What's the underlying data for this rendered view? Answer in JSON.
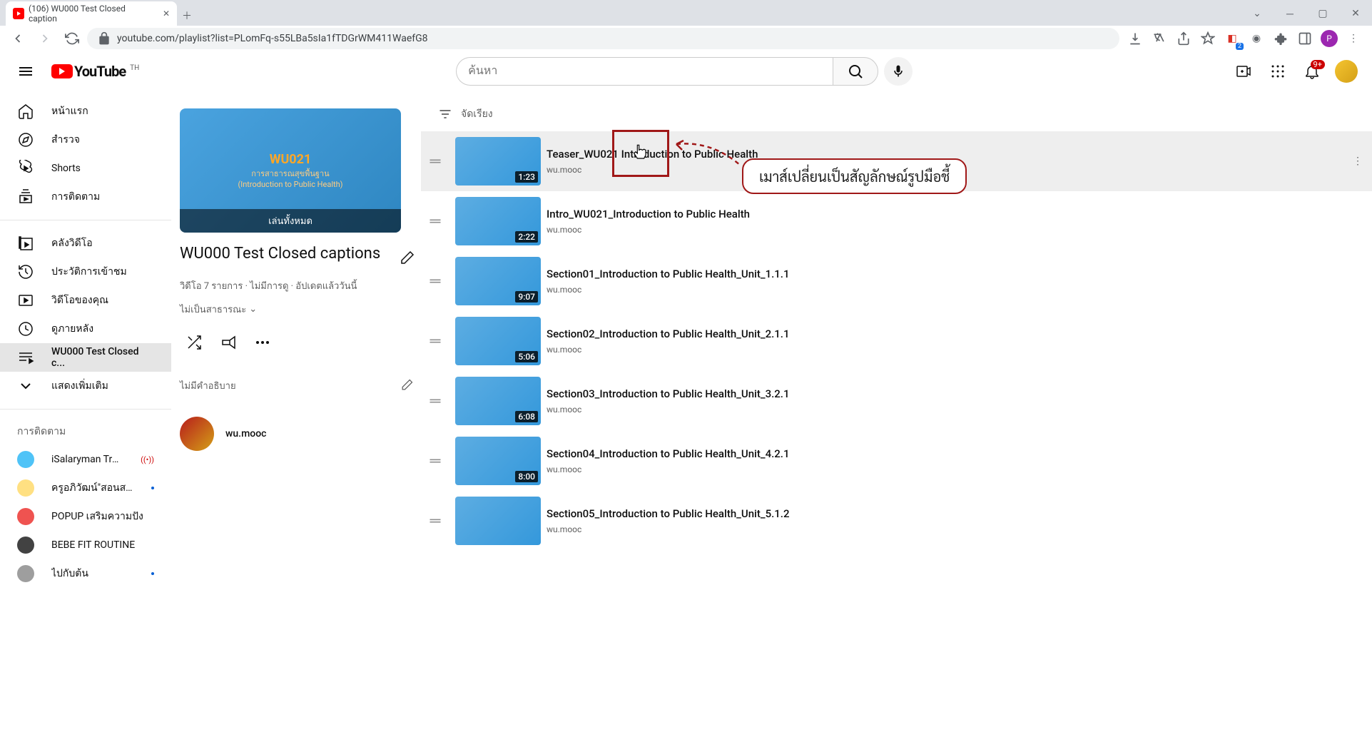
{
  "browser": {
    "tab_title": "(106) WU000 Test Closed caption",
    "url": "youtube.com/playlist?list=PLomFq-s55LBa5sIa1fTDGrWM411WaefG8",
    "ext_badge": "2",
    "profile_letter": "P"
  },
  "yt": {
    "logo_text": "YouTube",
    "logo_region": "TH",
    "search_placeholder": "ค้นหา",
    "notif_count": "9+"
  },
  "sidebar": {
    "items": [
      {
        "label": "หน้าแรก",
        "icon": "home"
      },
      {
        "label": "สำรวจ",
        "icon": "compass"
      },
      {
        "label": "Shorts",
        "icon": "shorts"
      },
      {
        "label": "การติดตาม",
        "icon": "subscriptions"
      }
    ],
    "library": [
      {
        "label": "คลังวิดีโอ",
        "icon": "library"
      },
      {
        "label": "ประวัติการเข้าชม",
        "icon": "history"
      },
      {
        "label": "วิดีโอของคุณ",
        "icon": "your-videos"
      },
      {
        "label": "ดูภายหลัง",
        "icon": "watch-later"
      },
      {
        "label": "WU000 Test Closed c...",
        "icon": "playlist",
        "active": true
      },
      {
        "label": "แสดงเพิ่มเติม",
        "icon": "chevron-down"
      }
    ],
    "subs_heading": "การติดตาม",
    "subs": [
      {
        "name": "iSalaryman Trader",
        "live": true,
        "color": "#4fc3f7"
      },
      {
        "name": "ครูอภิวัฒน์\"สอนสร้าง...",
        "dot": true,
        "color": "#ffe082"
      },
      {
        "name": "POPUP เสริมความปัง",
        "dot": false,
        "color": "#ef5350"
      },
      {
        "name": "BEBE FIT ROUTINE",
        "dot": false,
        "color": "#424242"
      },
      {
        "name": "ไปกับต้น",
        "dot": true,
        "color": "#9e9e9e"
      }
    ]
  },
  "playlist": {
    "thumb_play_all": "เล่นทั้งหมด",
    "thumb_code": "WU021",
    "thumb_line1": "การสาธารณสุขพื้นฐาน",
    "thumb_line2": "(Introduction to Public Health)",
    "title": "WU000 Test Closed captions",
    "meta": "วิดีโอ 7 รายการ · ไม่มีการดู · อัปเดตแล้ววันนี้",
    "privacy": "ไม่เป็นสาธารณะ",
    "desc_placeholder": "ไม่มีคำอธิบาย",
    "owner": "wu.mooc"
  },
  "sort_label": "จัดเรียง",
  "videos": [
    {
      "title": "Teaser_WU021 Introduction to Public Health",
      "channel": "wu.mooc",
      "dur": "1:23",
      "hover": true
    },
    {
      "title": "Intro_WU021_Introduction to Public Health",
      "channel": "wu.mooc",
      "dur": "2:22"
    },
    {
      "title": "Section01_Introduction to Public Health_Unit_1.1.1",
      "channel": "wu.mooc",
      "dur": "9:07"
    },
    {
      "title": "Section02_Introduction to Public Health_Unit_2.1.1",
      "channel": "wu.mooc",
      "dur": "5:06"
    },
    {
      "title": "Section03_Introduction to Public Health_Unit_3.2.1",
      "channel": "wu.mooc",
      "dur": "6:08"
    },
    {
      "title": "Section04_Introduction to Public Health_Unit_4.2.1",
      "channel": "wu.mooc",
      "dur": "8:00"
    },
    {
      "title": "Section05_Introduction to Public Health_Unit_5.1.2",
      "channel": "wu.mooc",
      "dur": ""
    }
  ],
  "annotation": {
    "text": "เมาส์เปลี่ยนเป็นสัญลักษณ์รูปมือชี้"
  }
}
